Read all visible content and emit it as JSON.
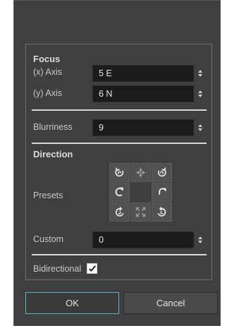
{
  "focus": {
    "title": "Focus",
    "x_label": "(x) Axis",
    "x_value": "5 E",
    "y_label": "(y) Axis",
    "y_value": "6 N"
  },
  "blurriness": {
    "label": "Blurriness",
    "value": "9"
  },
  "direction": {
    "title": "Direction",
    "presets_label": "Presets",
    "custom_label": "Custom",
    "custom_value": "0"
  },
  "bidirectional": {
    "label": "Bidirectional",
    "checked": true
  },
  "buttons": {
    "ok": "OK",
    "cancel": "Cancel"
  },
  "icons": {
    "spin": "spinbox-arrows-icon",
    "check": "checkmark-icon"
  },
  "colors": {
    "dialog_bg": "#3f3f3f",
    "field_bg": "#1b1b1b",
    "ok_border": "#5fb3c9"
  }
}
